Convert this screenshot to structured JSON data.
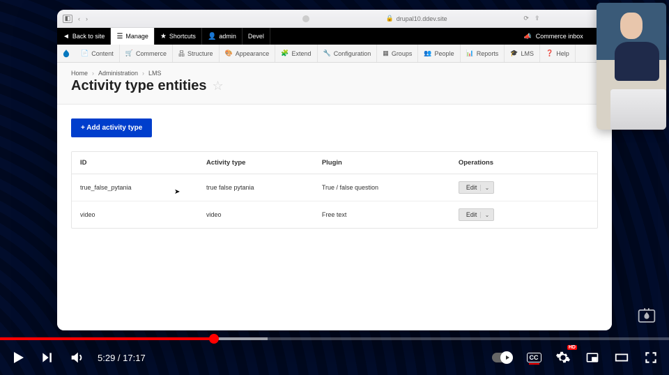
{
  "browser": {
    "address": "drupal10.ddev.site",
    "lock_label": "lock"
  },
  "adminbar": {
    "back_to_site": "Back to site",
    "manage": "Manage",
    "shortcuts": "Shortcuts",
    "admin": "admin",
    "devel": "Devel",
    "commerce_inbox": "Commerce inbox"
  },
  "nav": {
    "content": "Content",
    "commerce": "Commerce",
    "structure": "Structure",
    "appearance": "Appearance",
    "extend": "Extend",
    "configuration": "Configuration",
    "groups": "Groups",
    "people": "People",
    "reports": "Reports",
    "lms": "LMS",
    "help": "Help"
  },
  "breadcrumbs": [
    "Home",
    "Administration",
    "LMS"
  ],
  "page_title": "Activity type entities",
  "add_button": "+ Add activity type",
  "table": {
    "headers": {
      "id": "ID",
      "activity_type": "Activity type",
      "plugin": "Plugin",
      "operations": "Operations"
    },
    "rows": [
      {
        "id": "true_false_pytania",
        "activity_type": "true false pytania",
        "plugin": "True / false question",
        "op": "Edit"
      },
      {
        "id": "video",
        "activity_type": "video",
        "plugin": "Free text",
        "op": "Edit"
      }
    ]
  },
  "video": {
    "current": "5:29",
    "duration": "17:17",
    "cc": "CC",
    "hd": "HD"
  }
}
